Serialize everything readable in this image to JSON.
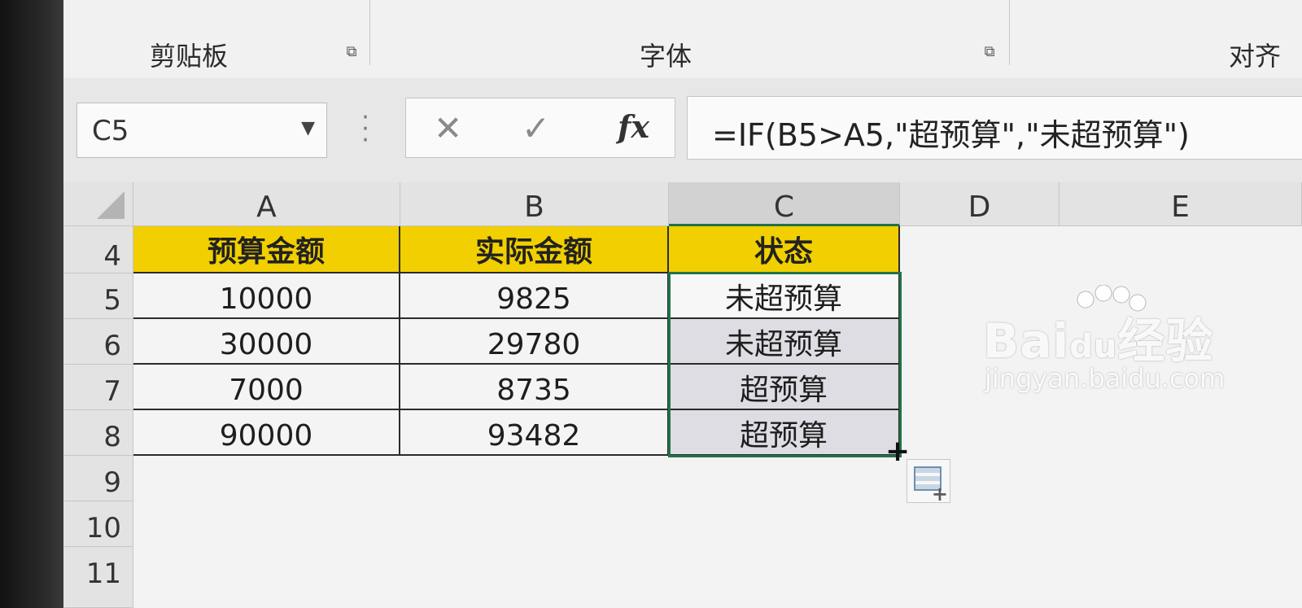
{
  "ribbon": {
    "groups": [
      {
        "label": "剪贴板"
      },
      {
        "label": "字体"
      },
      {
        "label": "对齐"
      }
    ]
  },
  "formula_bar": {
    "name_box": "C5",
    "cancel_glyph": "✕",
    "enter_glyph": "✓",
    "fx_label": "fx",
    "formula": "=IF(B5>A5,\"超预算\",\"未超预算\")"
  },
  "sheet": {
    "columns": [
      "A",
      "B",
      "C",
      "D",
      "E"
    ],
    "rows": [
      "4",
      "5",
      "6",
      "7",
      "8",
      "9",
      "10",
      "11"
    ],
    "headers": [
      "预算金额",
      "实际金额",
      "状态"
    ],
    "data": [
      [
        "10000",
        "9825",
        "未超预算"
      ],
      [
        "30000",
        "29780",
        "未超预算"
      ],
      [
        "7000",
        "8735",
        "超预算"
      ],
      [
        "90000",
        "93482",
        "超预算"
      ]
    ],
    "active_cell": "C5",
    "header_fill": "#f2cf00",
    "selection_color": "#217346"
  },
  "watermark": {
    "brand": "Bai",
    "brand_suffix": "经验",
    "paw_text": "du",
    "url": "jingyan.baidu.com"
  }
}
